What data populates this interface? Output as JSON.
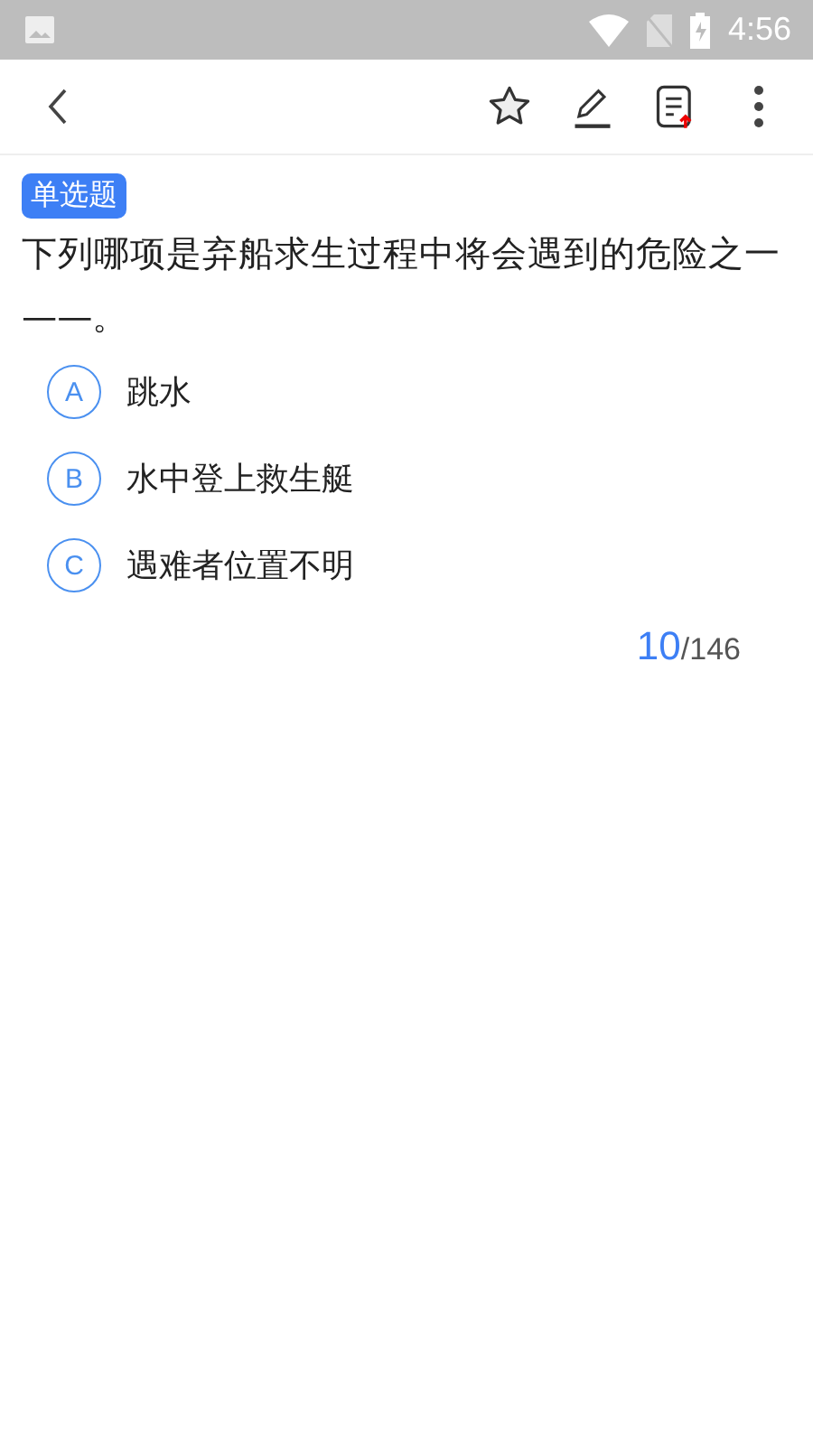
{
  "status_bar": {
    "time": "4:56"
  },
  "question": {
    "type_label": "单选题",
    "text": "下列哪项是弃船求生过程中将会遇到的危险之一——。",
    "options": [
      {
        "letter": "A",
        "text": "跳水",
        "selected": false
      },
      {
        "letter": "B",
        "text": "水中登上救生艇",
        "selected": false
      },
      {
        "letter": "C",
        "text": "遇难者位置不明",
        "selected": false
      }
    ]
  },
  "progress": {
    "current": "10",
    "total": "/146"
  }
}
